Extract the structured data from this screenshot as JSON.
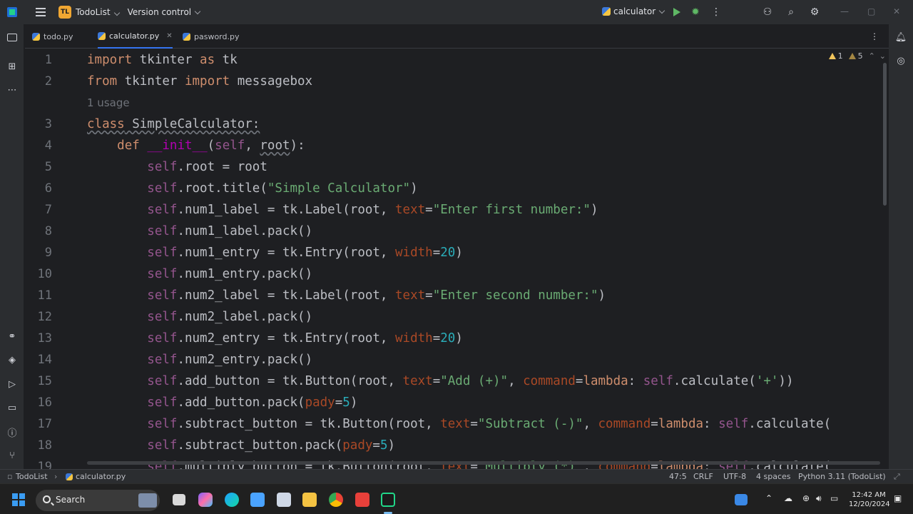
{
  "titlebar": {
    "project_badge": "TL",
    "project_name": "TodoList",
    "vcs_label": "Version control",
    "run_config": "calculator"
  },
  "tabs": [
    {
      "label": "todo.py",
      "active": false
    },
    {
      "label": "calculator.py",
      "active": true
    },
    {
      "label": "pasword.py",
      "active": false
    }
  ],
  "inspections": {
    "warnings": "1",
    "weak_warnings": "5"
  },
  "editor": {
    "usage_hint": "1 usage"
  },
  "statusbar": {
    "project": "TodoList",
    "file": "calculator.py",
    "position": "47:5",
    "line_ending": "CRLF",
    "encoding": "UTF-8",
    "indent": "4 spaces",
    "interpreter": "Python 3.11 (TodoList)"
  },
  "taskbar": {
    "search_label": "Search",
    "time": "12:42 AM",
    "date": "12/20/2024"
  },
  "colors": {
    "accent": "#3574f0",
    "keyword": "#cf8e6d",
    "string": "#6aab73",
    "number": "#2aacb8",
    "self": "#94558d"
  },
  "icons": [
    "app-logo-icon",
    "hamburger-icon",
    "python-file-icon",
    "run-icon",
    "debug-icon",
    "more-icon",
    "user-icon",
    "search-icon",
    "gear-icon",
    "folder-icon",
    "structure-icon",
    "notifications-icon",
    "ai-icon",
    "warning-icon"
  ]
}
